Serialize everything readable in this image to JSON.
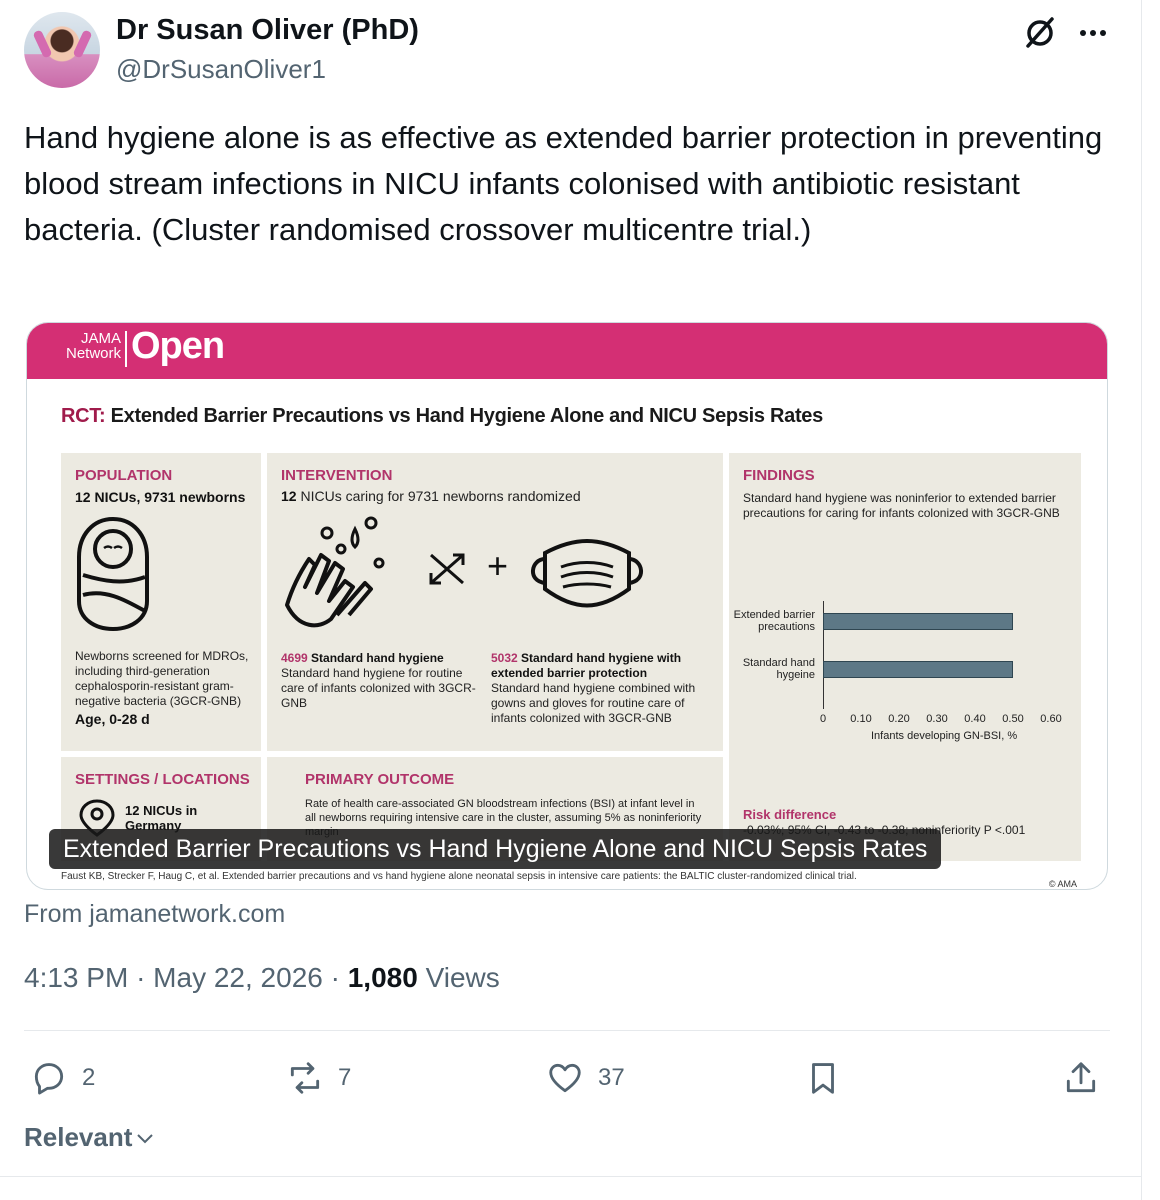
{
  "author": {
    "name": "Dr Susan Oliver (PhD)",
    "handle": "@DrSusanOliver1"
  },
  "tweet": {
    "text": "Hand hygiene alone is as effective as extended barrier protection in preventing blood stream infections in NICU infants colonised with antibiotic resistant bacteria. (Cluster randomised crossover multicentre trial.)"
  },
  "media": {
    "journal_small_1": "JAMA",
    "journal_small_2": "Network",
    "journal_big": "Open",
    "title_prefix": "RCT:",
    "title_rest": "Extended Barrier Precautions vs Hand Hygiene Alone and NICU Sepsis Rates",
    "population": {
      "heading": "POPULATION",
      "sub": "12 NICUs, 9731 newborns",
      "body": "Newborns screened for MDROs, including third-generation cephalosporin-resistant gram-negative bacteria (3GCR-GNB)",
      "age": "Age, 0-28 d"
    },
    "intervention": {
      "heading": "INTERVENTION",
      "sub_num": "12",
      "sub_text": "NICUs caring for 9731 newborns randomized",
      "arm1_num": "4699",
      "arm1_title": "Standard hand hygiene",
      "arm1_body": "Standard hand hygiene for routine care of infants colonized with 3GCR-GNB",
      "arm2_num": "5032",
      "arm2_title": "Standard hand hygiene with extended barrier protection",
      "arm2_body": "Standard hand hygiene combined with gowns and gloves for routine care of infants colonized with 3GCR-GNB",
      "plus": "+"
    },
    "findings": {
      "heading": "FINDINGS",
      "body": "Standard hand hygiene was noninferior to extended barrier precautions for caring for infants colonized with 3GCR-GNB",
      "risk_heading": "Risk difference",
      "risk_text": "-0.03%; 95% CI, -0.43 to -0.38; noninferiority P <.001"
    },
    "settings": {
      "heading": "SETTINGS / LOCATIONS",
      "text": "12 NICUs in Germany"
    },
    "primary": {
      "heading": "PRIMARY OUTCOME",
      "body": "Rate of health care-associated GN bloodstream infections (BSI) at infant level in all newborns requiring intensive care in the cluster, assuming 5% as noninferiority margin"
    },
    "caption": "Extended Barrier Precautions vs Hand Hygiene Alone and NICU Sepsis Rates",
    "citation": "Faust KB, Strecker F, Haug C, et al. Extended barrier precautions and vs hand hygiene alone neonatal sepsis in intensive care patients: the BALTIC cluster-randomized clinical trial.",
    "copyright": "© AMA"
  },
  "chart_data": {
    "type": "bar",
    "orientation": "horizontal",
    "categories": [
      "Extended barrier precautions",
      "Standard hand hygeine"
    ],
    "values": [
      0.5,
      0.5
    ],
    "xlabel": "Infants developing GN-BSI, %",
    "xlim": [
      0,
      0.6
    ],
    "xticks": [
      "0",
      "0.10",
      "0.20",
      "0.30",
      "0.40",
      "0.50",
      "0.60"
    ],
    "bar_color": "#5d7886"
  },
  "source": "From jamanetwork.com",
  "meta": {
    "time": "4:13 PM",
    "sep1": "·",
    "date": "May 22, 2026",
    "sep2": "·",
    "views_count": "1,080",
    "views_label": "Views"
  },
  "actions": {
    "replies": "2",
    "reposts": "7",
    "likes": "37"
  },
  "sort": {
    "label": "Relevant"
  }
}
